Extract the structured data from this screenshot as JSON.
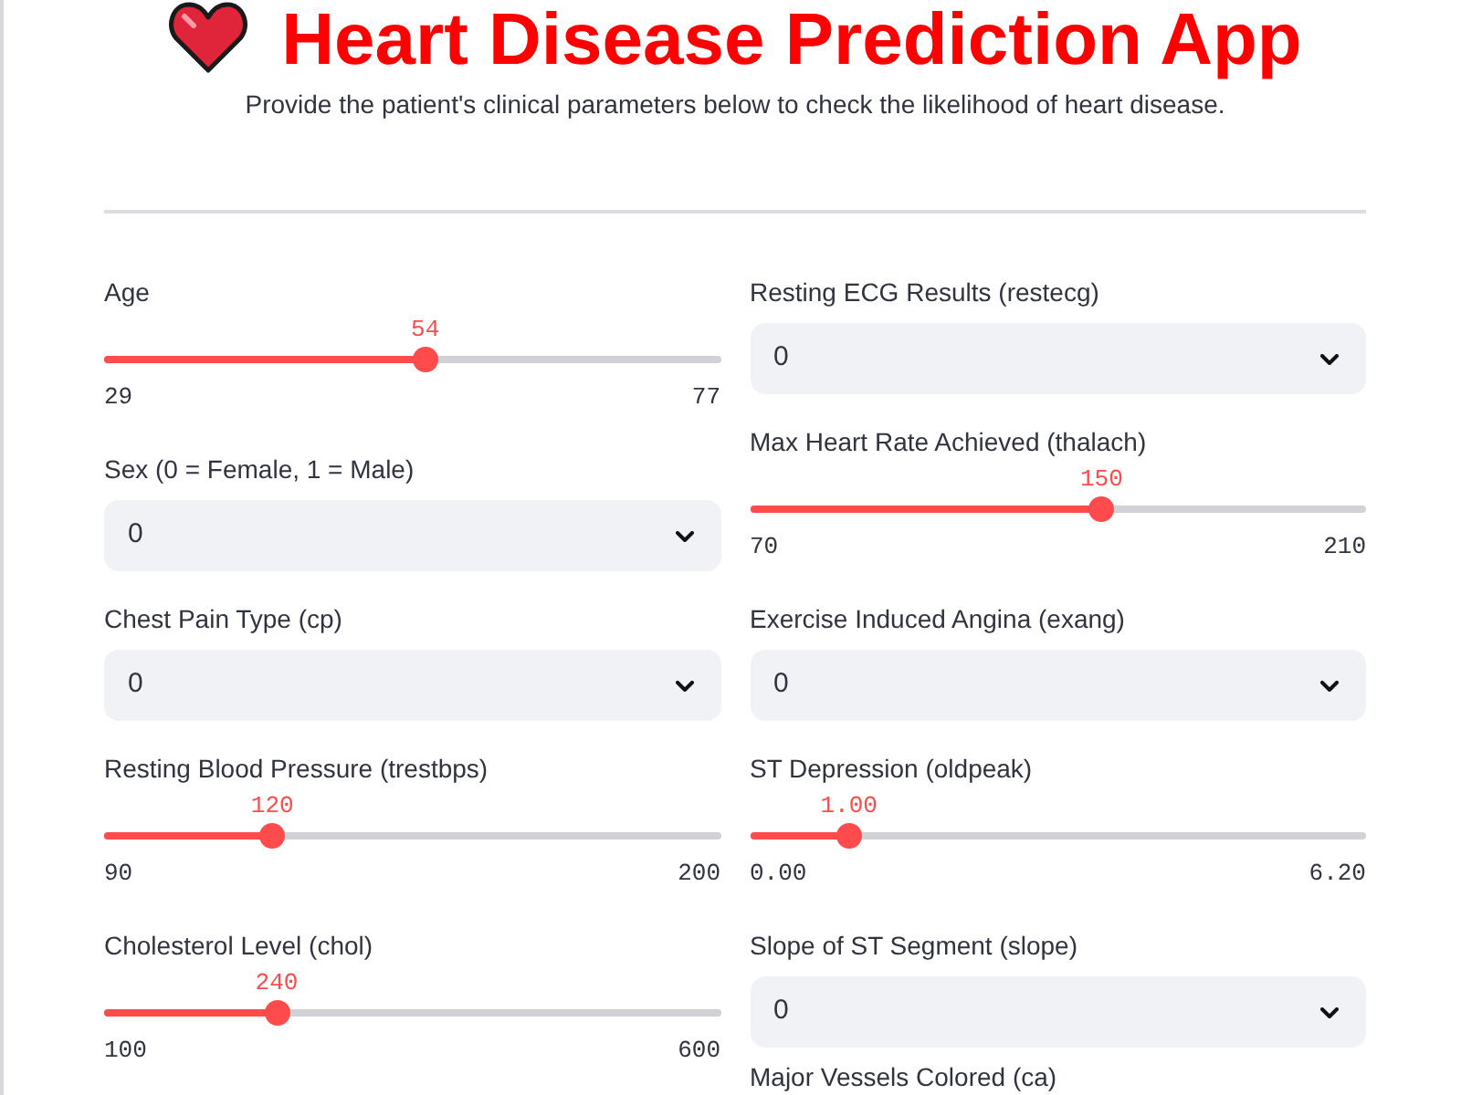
{
  "header": {
    "title": "Heart Disease Prediction App",
    "subtitle": "Provide the patient's clinical parameters below to check the likelihood of heart disease."
  },
  "columns": [
    {
      "widgets": [
        {
          "kind": "slider",
          "label": "Age",
          "value": "54",
          "min": "29",
          "max": "77",
          "level": 0.521
        },
        {
          "kind": "select",
          "label": "Sex (0 = Female, 1 = Male)",
          "value": "0"
        },
        {
          "kind": "select",
          "label": "Chest Pain Type (cp)",
          "value": "0"
        },
        {
          "kind": "slider",
          "label": "Resting Blood Pressure (trestbps)",
          "value": "120",
          "min": "90",
          "max": "200",
          "level": 0.273
        },
        {
          "kind": "slider",
          "label": "Cholesterol Level (chol)",
          "value": "240",
          "min": "100",
          "max": "600",
          "level": 0.28
        }
      ]
    },
    {
      "widgets": [
        {
          "kind": "select",
          "label": "Resting ECG Results (restecg)",
          "value": "0"
        },
        {
          "kind": "slider",
          "label": "Max Heart Rate Achieved (thalach)",
          "value": "150",
          "min": "70",
          "max": "210",
          "level": 0.571
        },
        {
          "kind": "select",
          "label": "Exercise Induced Angina (exang)",
          "value": "0"
        },
        {
          "kind": "slider",
          "label": "ST Depression (oldpeak)",
          "value": "1.00",
          "min": "0.00",
          "max": "6.20",
          "level": 0.161
        },
        {
          "kind": "select",
          "label": "Slope of ST Segment (slope)",
          "value": "0"
        },
        {
          "kind": "label",
          "label": "Major Vessels Colored (ca)"
        }
      ]
    }
  ]
}
